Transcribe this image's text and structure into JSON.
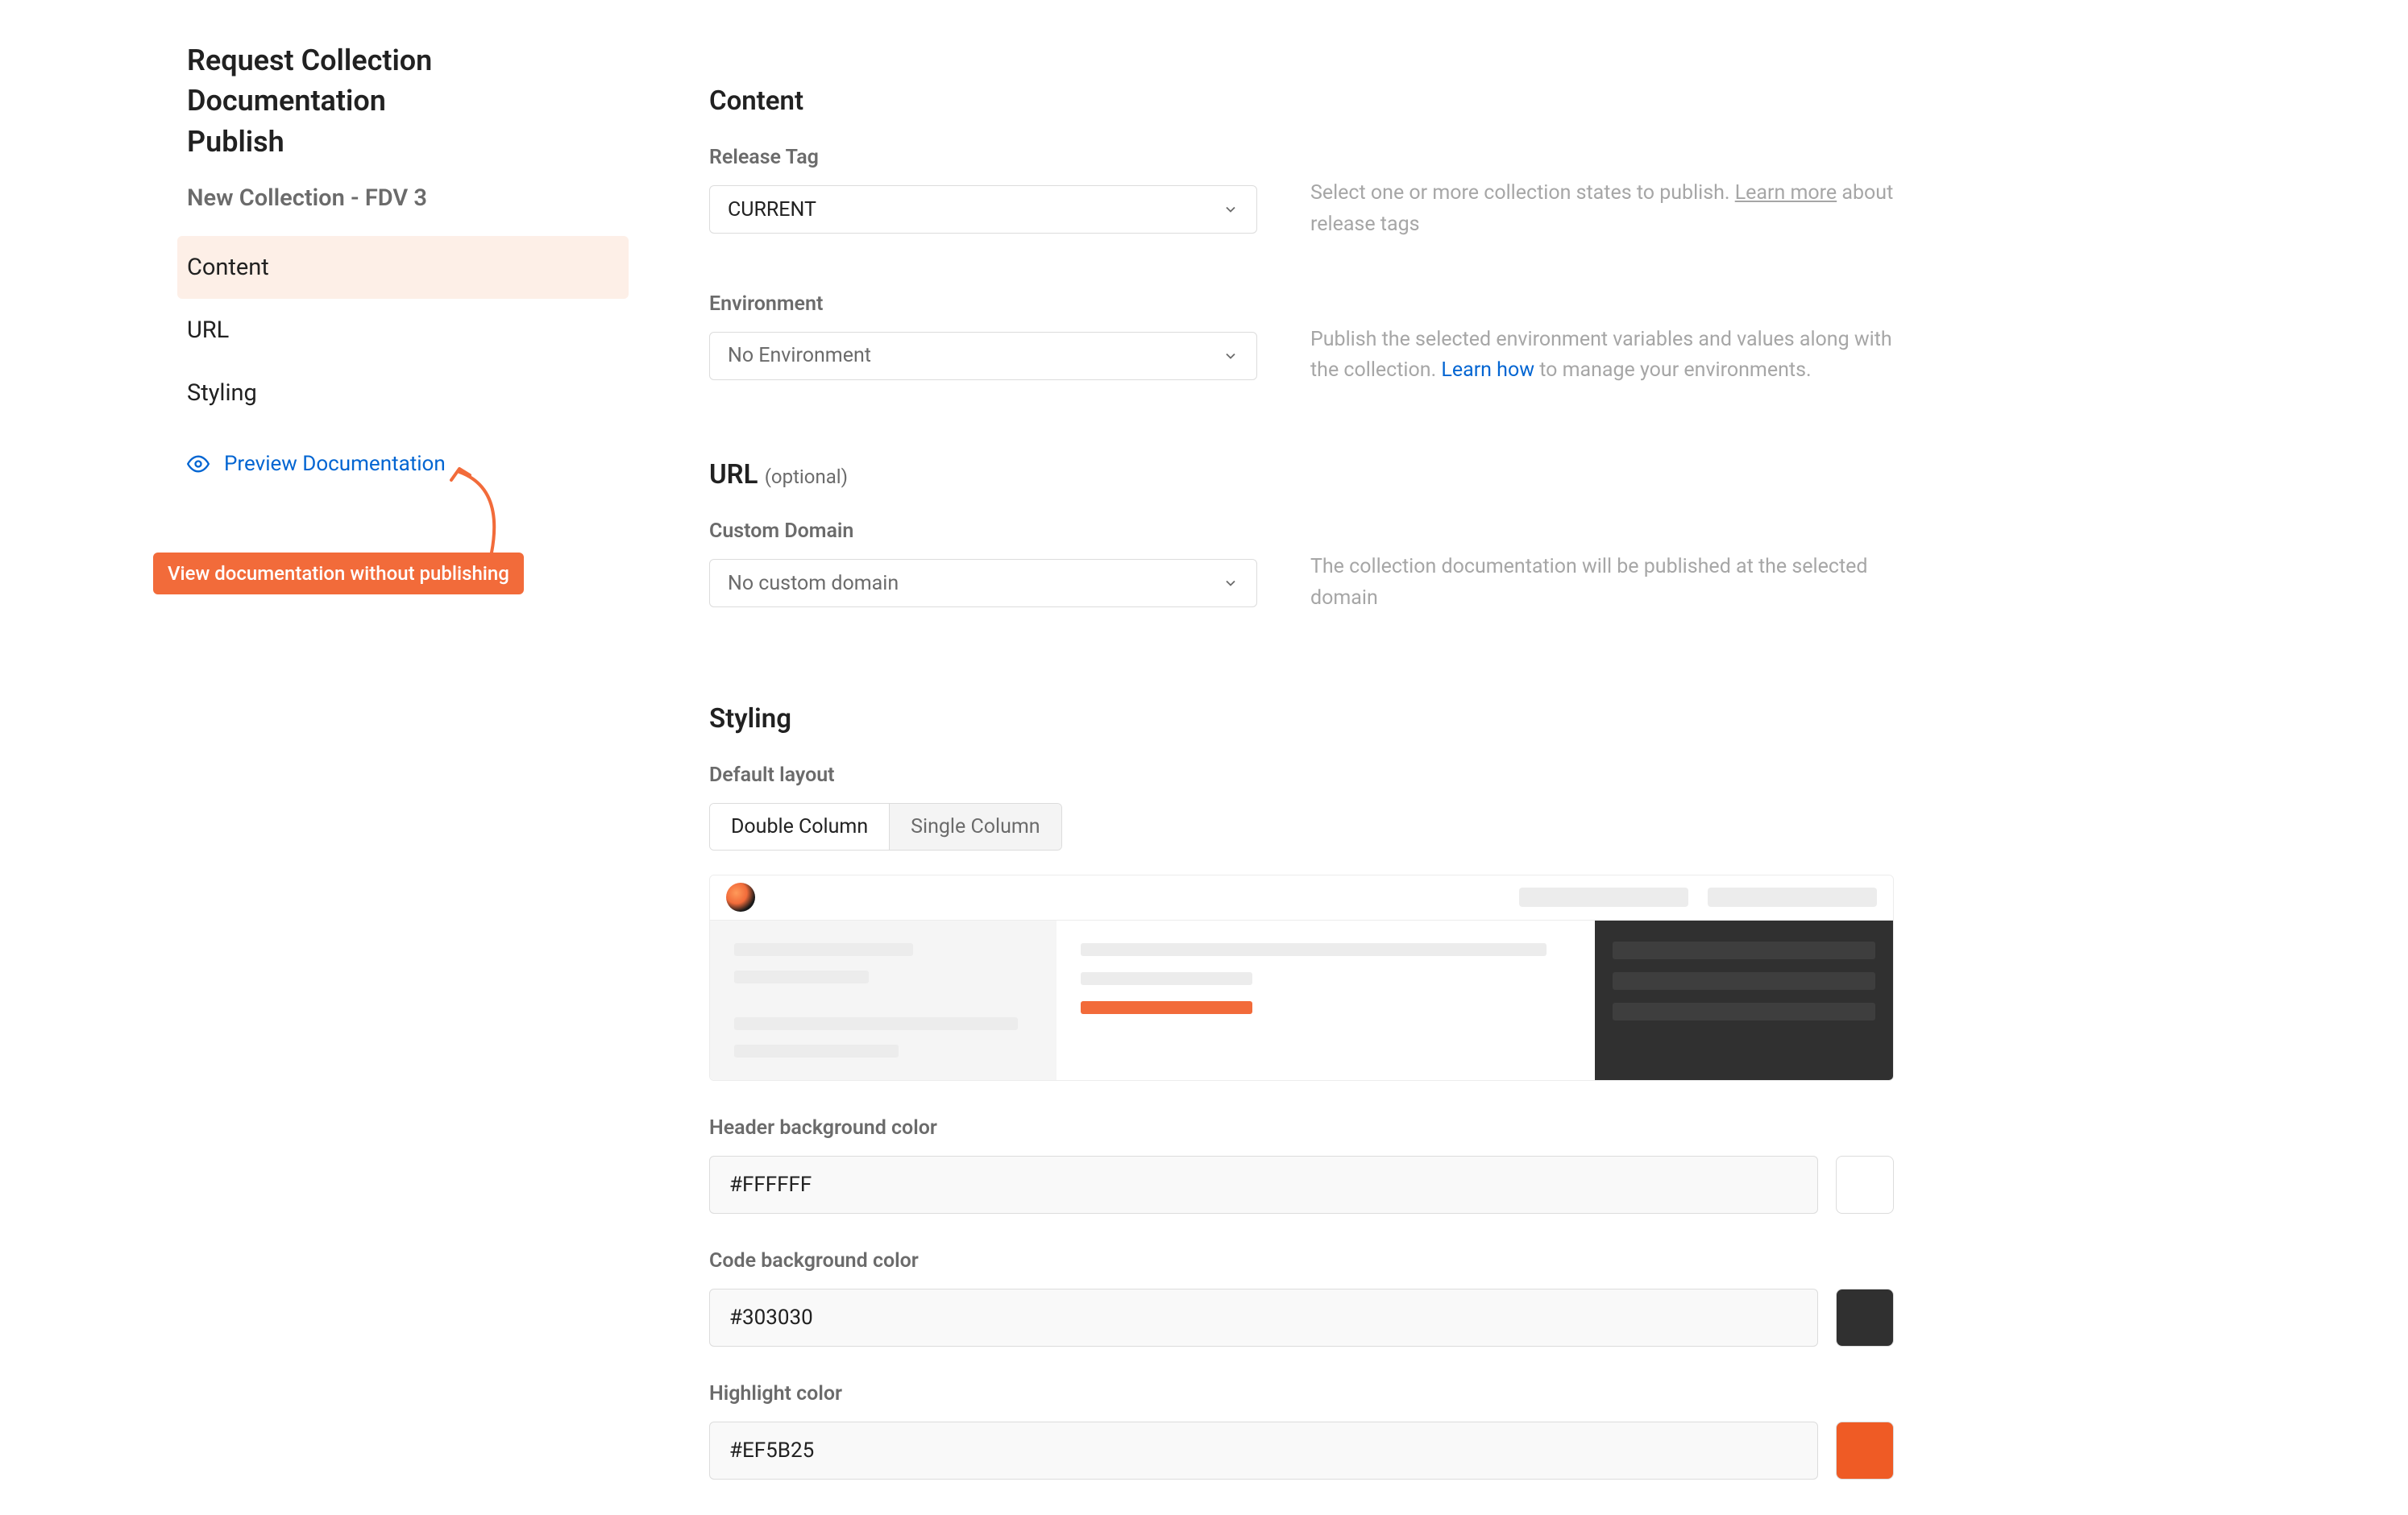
{
  "page": {
    "title_line1": "Request Collection Documentation",
    "title_line2": "Publish",
    "collection_name": "New Collection - FDV 3"
  },
  "sidebar": {
    "items": [
      {
        "label": "Content",
        "active": true
      },
      {
        "label": "URL",
        "active": false
      },
      {
        "label": "Styling",
        "active": false
      }
    ],
    "preview_link": "Preview Documentation",
    "callout": "View documentation without publishing"
  },
  "content_section": {
    "heading": "Content",
    "release_tag": {
      "label": "Release Tag",
      "value": "CURRENT",
      "help_prefix": "Select one or more collection states to publish. ",
      "help_link": "Learn more",
      "help_suffix": " about release tags"
    },
    "environment": {
      "label": "Environment",
      "placeholder": "No Environment",
      "help_prefix": "Publish the selected environment variables and values along with the collection. ",
      "help_link": "Learn how",
      "help_suffix": " to manage your environments."
    }
  },
  "url_section": {
    "heading": "URL",
    "optional": "(optional)",
    "custom_domain": {
      "label": "Custom Domain",
      "placeholder": "No custom domain",
      "help": "The collection documentation will be published at the selected domain"
    }
  },
  "styling_section": {
    "heading": "Styling",
    "default_layout": {
      "label": "Default layout",
      "options": [
        "Double Column",
        "Single Column"
      ],
      "selected": "Double Column"
    },
    "header_bg": {
      "label": "Header background color",
      "value": "#FFFFFF"
    },
    "code_bg": {
      "label": "Code background color",
      "value": "#303030"
    },
    "highlight": {
      "label": "Highlight color",
      "value": "#EF5B25"
    }
  }
}
